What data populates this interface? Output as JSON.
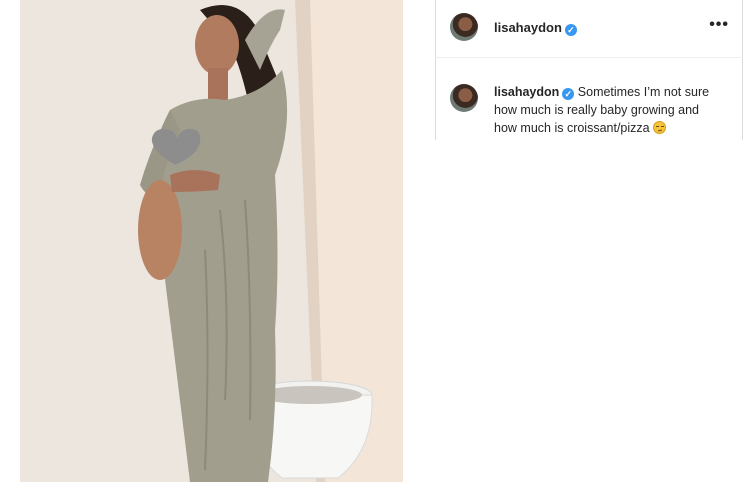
{
  "post": {
    "username": "lisahaydon",
    "verified_glyph": "✓",
    "more_label": "•••",
    "caption": "Sometimes I’m not sure how much is really baby growing and how much is croissant/pizza",
    "caption_emoji": "smirking-face-emoji"
  },
  "colors": {
    "verified": "#3897f0",
    "text": "#262626",
    "border": "#dbdbdb"
  }
}
